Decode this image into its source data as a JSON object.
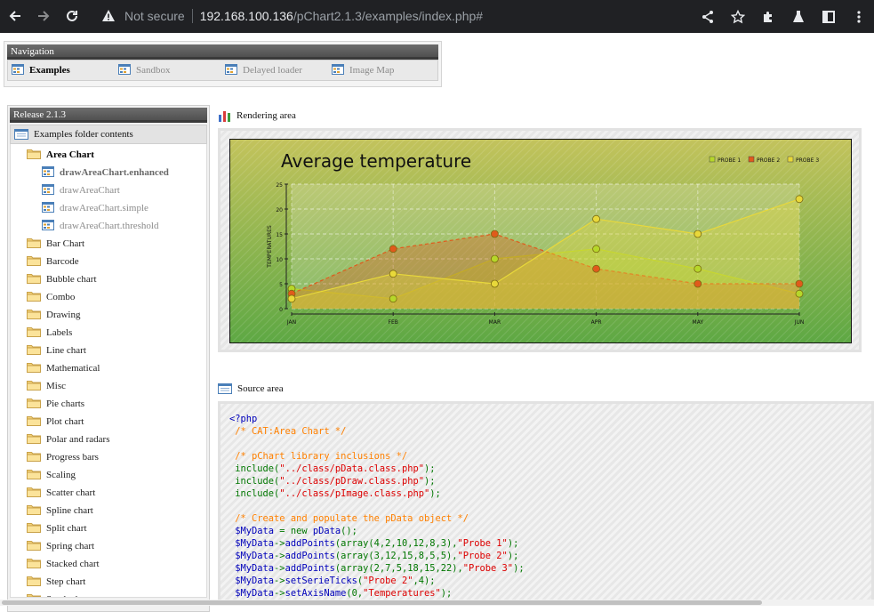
{
  "browser": {
    "not_secure": "Not secure",
    "url_host": "192.168.100.136",
    "url_path": "/pChart2.1.3/examples/index.php#"
  },
  "navigation": {
    "title": "Navigation",
    "tabs": [
      {
        "label": "Examples",
        "active": true
      },
      {
        "label": "Sandbox",
        "active": false
      },
      {
        "label": "Delayed loader",
        "active": false
      },
      {
        "label": "Image Map",
        "active": false
      }
    ]
  },
  "sidebar": {
    "title": "Release 2.1.3",
    "folder_header": "Examples folder contents",
    "open_folder": "Area Chart",
    "examples": [
      {
        "label": "drawAreaChart.enhanced",
        "active": true
      },
      {
        "label": "drawAreaChart",
        "active": false
      },
      {
        "label": "drawAreaChart.simple",
        "active": false
      },
      {
        "label": "drawAreaChart.threshold",
        "active": false
      }
    ],
    "folders": [
      "Bar Chart",
      "Barcode",
      "Bubble chart",
      "Combo",
      "Drawing",
      "Labels",
      "Line chart",
      "Mathematical",
      "Misc",
      "Pie charts",
      "Plot chart",
      "Polar and radars",
      "Progress bars",
      "Scaling",
      "Scatter chart",
      "Spline chart",
      "Split chart",
      "Spring chart",
      "Stacked chart",
      "Step chart",
      "Stock chart"
    ]
  },
  "rendering": {
    "label": "Rendering area"
  },
  "source": {
    "label": "Source area",
    "lines": [
      {
        "cls": "c-php",
        "text": "<?php"
      },
      {
        "cls": "c-comment",
        "text": " /* CAT:Area Chart */"
      },
      {
        "cls": "c-default",
        "text": " "
      },
      {
        "cls": "c-comment",
        "text": " /* pChart library inclusions */"
      },
      {
        "cls": "c-default",
        "parts": [
          [
            "c-default",
            " include("
          ],
          [
            "c-string",
            "\"../class/pData.class.php\""
          ],
          [
            "c-default",
            ");"
          ]
        ]
      },
      {
        "cls": "c-default",
        "parts": [
          [
            "c-default",
            " include("
          ],
          [
            "c-string",
            "\"../class/pDraw.class.php\""
          ],
          [
            "c-default",
            ");"
          ]
        ]
      },
      {
        "cls": "c-default",
        "parts": [
          [
            "c-default",
            " include("
          ],
          [
            "c-string",
            "\"../class/pImage.class.php\""
          ],
          [
            "c-default",
            ");"
          ]
        ]
      },
      {
        "cls": "c-default",
        "text": " "
      },
      {
        "cls": "c-comment",
        "text": " /* Create and populate the pData object */"
      },
      {
        "cls": "c-default",
        "parts": [
          [
            "c-var",
            " $MyData"
          ],
          [
            "c-default",
            " = new "
          ],
          [
            "c-var",
            "pData"
          ],
          [
            "c-default",
            "();"
          ]
        ]
      },
      {
        "cls": "c-default",
        "parts": [
          [
            "c-var",
            " $MyData"
          ],
          [
            "c-default",
            "->"
          ],
          [
            "c-var",
            "addPoints"
          ],
          [
            "c-default",
            "(array(4,2,10,12,8,3),"
          ],
          [
            "c-string",
            "\"Probe 1\""
          ],
          [
            "c-default",
            ");"
          ]
        ]
      },
      {
        "cls": "c-default",
        "parts": [
          [
            "c-var",
            " $MyData"
          ],
          [
            "c-default",
            "->"
          ],
          [
            "c-var",
            "addPoints"
          ],
          [
            "c-default",
            "(array(3,12,15,8,5,5),"
          ],
          [
            "c-string",
            "\"Probe 2\""
          ],
          [
            "c-default",
            ");"
          ]
        ]
      },
      {
        "cls": "c-default",
        "parts": [
          [
            "c-var",
            " $MyData"
          ],
          [
            "c-default",
            "->"
          ],
          [
            "c-var",
            "addPoints"
          ],
          [
            "c-default",
            "(array(2,7,5,18,15,22),"
          ],
          [
            "c-string",
            "\"Probe 3\""
          ],
          [
            "c-default",
            ");"
          ]
        ]
      },
      {
        "cls": "c-default",
        "parts": [
          [
            "c-var",
            " $MyData"
          ],
          [
            "c-default",
            "->"
          ],
          [
            "c-var",
            "setSerieTicks"
          ],
          [
            "c-default",
            "("
          ],
          [
            "c-string",
            "\"Probe 2\""
          ],
          [
            "c-default",
            ",4);"
          ]
        ]
      },
      {
        "cls": "c-default",
        "parts": [
          [
            "c-var",
            " $MyData"
          ],
          [
            "c-default",
            "->"
          ],
          [
            "c-var",
            "setAxisName"
          ],
          [
            "c-default",
            "(0,"
          ],
          [
            "c-string",
            "\"Temperatures\""
          ],
          [
            "c-default",
            ");"
          ]
        ]
      }
    ]
  },
  "chart_data": {
    "type": "area",
    "title": "Average temperature",
    "ylabel": "TEMPERATURES",
    "categories": [
      "JAN",
      "FEB",
      "MAR",
      "APR",
      "MAY",
      "JUN"
    ],
    "ylim": [
      0,
      25
    ],
    "yticks": [
      0,
      5,
      10,
      15,
      20,
      25
    ],
    "grid": true,
    "legend_position": "top-right",
    "series": [
      {
        "name": "PROBE 1",
        "values": [
          4,
          2,
          10,
          12,
          8,
          3
        ],
        "color": "#b6d72a"
      },
      {
        "name": "PROBE 2",
        "values": [
          3,
          12,
          15,
          8,
          5,
          5
        ],
        "color": "#e05a1c"
      },
      {
        "name": "PROBE 3",
        "values": [
          2,
          7,
          5,
          18,
          15,
          22
        ],
        "color": "#e8d83a"
      }
    ]
  }
}
